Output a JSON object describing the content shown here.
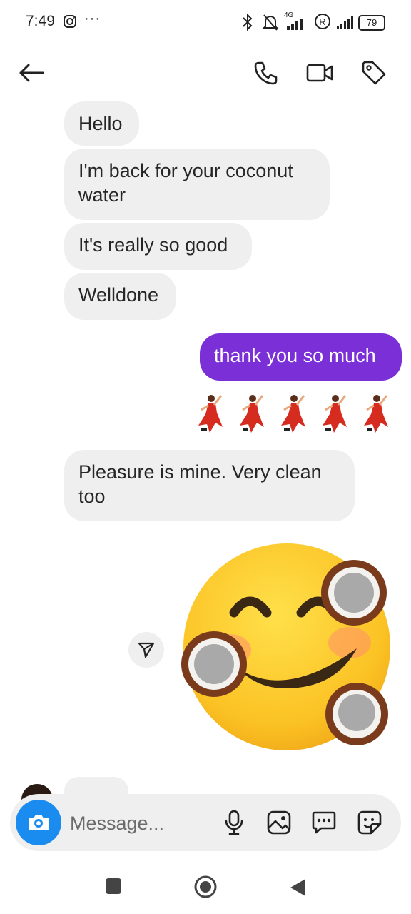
{
  "status_bar": {
    "time": "7:49",
    "dots": "···",
    "network": "4G",
    "battery": "79"
  },
  "header": {
    "back_icon": "arrow-left-icon",
    "call_icon": "phone-icon",
    "video_icon": "video-camera-icon",
    "tag_icon": "tag-icon"
  },
  "messages": [
    {
      "sender": "other",
      "text": "Hello"
    },
    {
      "sender": "other",
      "text": "I'm back for your coconut water"
    },
    {
      "sender": "other",
      "text": "It's really so good"
    },
    {
      "sender": "other",
      "text": "Welldone"
    },
    {
      "sender": "me",
      "text": "thank you so much"
    },
    {
      "sender": "me",
      "emoji": "💃💃💃💃💃"
    },
    {
      "sender": "other",
      "text": "Pleasure is mine. Very clean too"
    },
    {
      "sender": "me",
      "sticker": "smiling-face-coconut-sticker"
    }
  ],
  "composer": {
    "placeholder": "Message...",
    "icons": [
      "camera-icon",
      "microphone-icon",
      "gallery-icon",
      "chat-options-icon",
      "sticker-icon"
    ]
  },
  "colors": {
    "my_bubble": "#7b2fd6",
    "their_bubble": "#efefef",
    "camera_button": "#1a8cf0"
  }
}
